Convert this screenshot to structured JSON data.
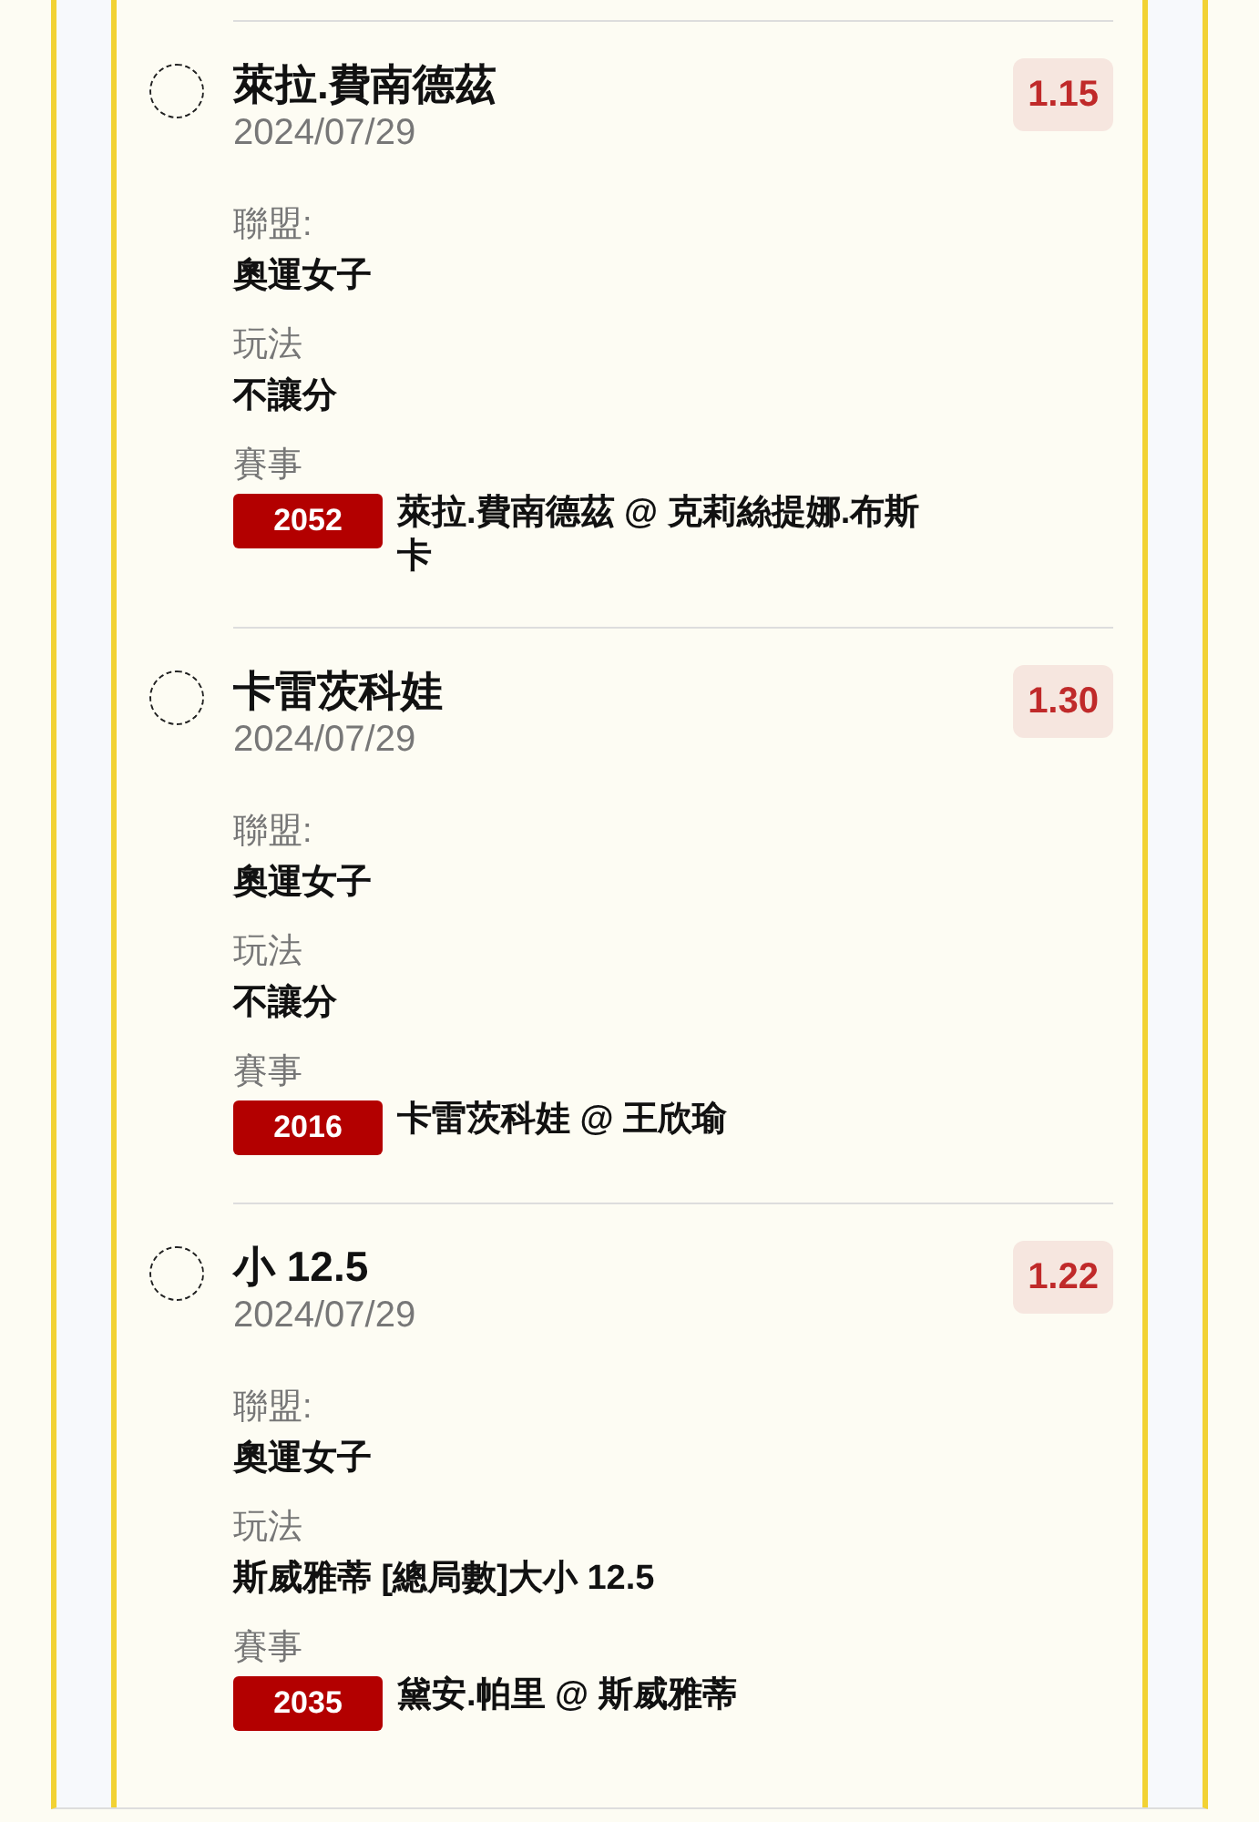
{
  "bets": [
    {
      "selected": false,
      "selection": "萊拉.費南德茲",
      "date": "2024/07/29",
      "odds": "1.15",
      "fields": [
        {
          "kind": "text",
          "label": "聯盟:",
          "value": "奧運女子"
        },
        {
          "kind": "text",
          "label": "玩法",
          "value": "不讓分"
        },
        {
          "kind": "event",
          "label": "賽事",
          "code": "2052",
          "value": "萊拉.費南德茲 @ 克莉絲提娜.布斯卡"
        }
      ]
    },
    {
      "selected": false,
      "selection": "卡雷茨科娃",
      "date": "2024/07/29",
      "odds": "1.30",
      "fields": [
        {
          "kind": "text",
          "label": "聯盟:",
          "value": "奧運女子"
        },
        {
          "kind": "text",
          "label": "玩法",
          "value": "不讓分"
        },
        {
          "kind": "event",
          "label": "賽事",
          "code": "2016",
          "value": "卡雷茨科娃 @ 王欣瑜"
        }
      ]
    },
    {
      "selected": false,
      "selection": "小 12.5",
      "date": "2024/07/29",
      "odds": "1.22",
      "fields": [
        {
          "kind": "text",
          "label": "聯盟:",
          "value": "奧運女子"
        },
        {
          "kind": "text",
          "label": "玩法",
          "value": "斯威雅蒂 [總局數]大小 12.5"
        },
        {
          "kind": "event",
          "label": "賽事",
          "code": "2035",
          "value": "黛安.帕里 @ 斯威雅蒂"
        }
      ]
    }
  ]
}
